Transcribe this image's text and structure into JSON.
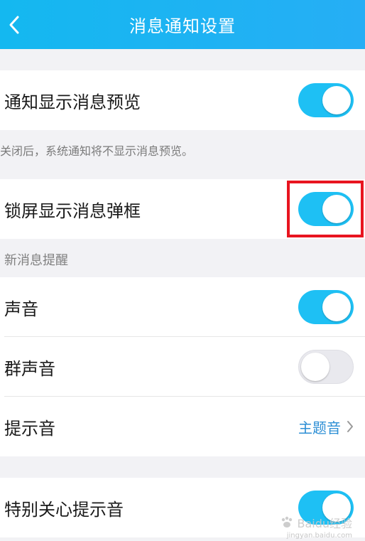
{
  "header": {
    "title": "消息通知设置"
  },
  "rows": {
    "preview": {
      "label": "通知显示消息预览",
      "on": true
    },
    "preview_hint": "关闭后，系统通知将不显示消息预览。",
    "lockscreen": {
      "label": "锁屏显示消息弹框",
      "on": true
    },
    "section_new_msg": "新消息提醒",
    "sound": {
      "label": "声音",
      "on": true
    },
    "group_sound": {
      "label": "群声音",
      "on": false
    },
    "tone": {
      "label": "提示音",
      "value": "主题音"
    },
    "special_tone": {
      "label": "特别关心提示音",
      "on": true
    }
  },
  "watermark": {
    "text": "Baidu经验",
    "sub": "jingyan.baidu.com"
  },
  "colors": {
    "header": "#1ab4f2",
    "toggle_on": "#1ec0f4",
    "highlight": "#e8141f",
    "link": "#2d8fd5"
  }
}
